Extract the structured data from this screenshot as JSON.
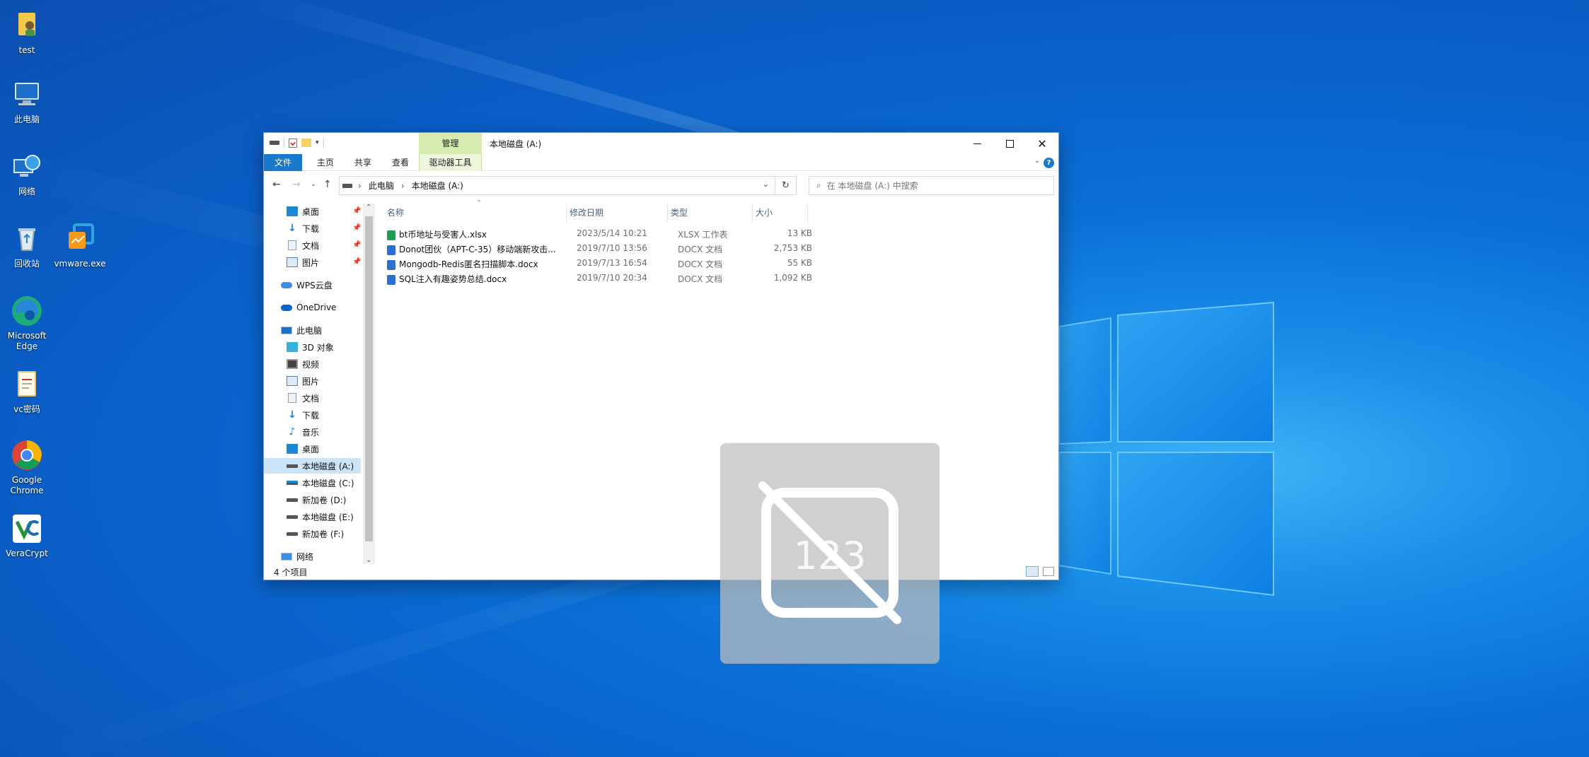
{
  "desktop": {
    "icons": [
      {
        "label": "test",
        "icon": "user-folder-icon"
      },
      {
        "label": "此电脑",
        "icon": "computer-icon"
      },
      {
        "label": "网络",
        "icon": "network-icon"
      },
      {
        "label": "回收站",
        "icon": "recycle-bin-icon"
      },
      {
        "label": "vmware.exe",
        "icon": "vmware-icon"
      },
      {
        "label": "Microsoft Edge",
        "icon": "edge-icon"
      },
      {
        "label": "vc密码",
        "icon": "text-file-icon"
      },
      {
        "label": "Google Chrome",
        "icon": "chrome-icon"
      },
      {
        "label": "VeraCrypt",
        "icon": "veracrypt-icon"
      }
    ]
  },
  "window": {
    "title": "本地磁盘 (A:)",
    "manage_tab": "管理",
    "ribbon_tabs": [
      "文件",
      "主页",
      "共享",
      "查看",
      "驱动器工具"
    ],
    "address": {
      "crumb1": "此电脑",
      "crumb2": "本地磁盘 (A:)"
    },
    "search_placeholder": "在 本地磁盘 (A:) 中搜索",
    "nav": {
      "quick_access": [
        {
          "label": "桌面",
          "icon": "desktop-icon"
        },
        {
          "label": "下载",
          "icon": "download-icon"
        },
        {
          "label": "文档",
          "icon": "documents-icon"
        },
        {
          "label": "图片",
          "icon": "pictures-icon"
        }
      ],
      "wps": "WPS云盘",
      "onedrive": "OneDrive",
      "this_pc": "此电脑",
      "pc_items": [
        {
          "label": "3D 对象",
          "icon": "3d-objects-icon"
        },
        {
          "label": "视频",
          "icon": "videos-icon"
        },
        {
          "label": "图片",
          "icon": "pictures-icon"
        },
        {
          "label": "文档",
          "icon": "documents-icon"
        },
        {
          "label": "下载",
          "icon": "download-icon"
        },
        {
          "label": "音乐",
          "icon": "music-icon"
        },
        {
          "label": "桌面",
          "icon": "desktop-icon"
        },
        {
          "label": "本地磁盘 (A:)",
          "icon": "drive-icon"
        },
        {
          "label": "本地磁盘 (C:)",
          "icon": "drive-icon"
        },
        {
          "label": "新加卷 (D:)",
          "icon": "drive-icon"
        },
        {
          "label": "本地磁盘 (E:)",
          "icon": "drive-icon"
        },
        {
          "label": "新加卷 (F:)",
          "icon": "drive-icon"
        }
      ],
      "network": "网络"
    },
    "columns": [
      "名称",
      "修改日期",
      "类型",
      "大小"
    ],
    "files": [
      {
        "name": "bt币地址与受害人.xlsx",
        "date": "2023/5/14 10:21",
        "type": "XLSX 工作表",
        "size": "13 KB",
        "kind": "xlsx"
      },
      {
        "name": "Donot团伙（APT-C-35）移动端新攻击...",
        "date": "2019/7/10 13:56",
        "type": "DOCX 文档",
        "size": "2,753 KB",
        "kind": "docx"
      },
      {
        "name": "Mongodb-Redis匿名扫描脚本.docx",
        "date": "2019/7/13 16:54",
        "type": "DOCX 文档",
        "size": "55 KB",
        "kind": "docx"
      },
      {
        "name": "SQL注入有趣姿势总结.docx",
        "date": "2019/7/10 20:34",
        "type": "DOCX 文档",
        "size": "1,092 KB",
        "kind": "docx"
      }
    ],
    "status": "4 个项目"
  },
  "overlay": {
    "icon": "no-numeric-keypad-icon",
    "text": "123"
  },
  "colors": {
    "accent": "#1979ca",
    "manage_tab": "#d7ebb0",
    "selection": "#cce4f7"
  }
}
